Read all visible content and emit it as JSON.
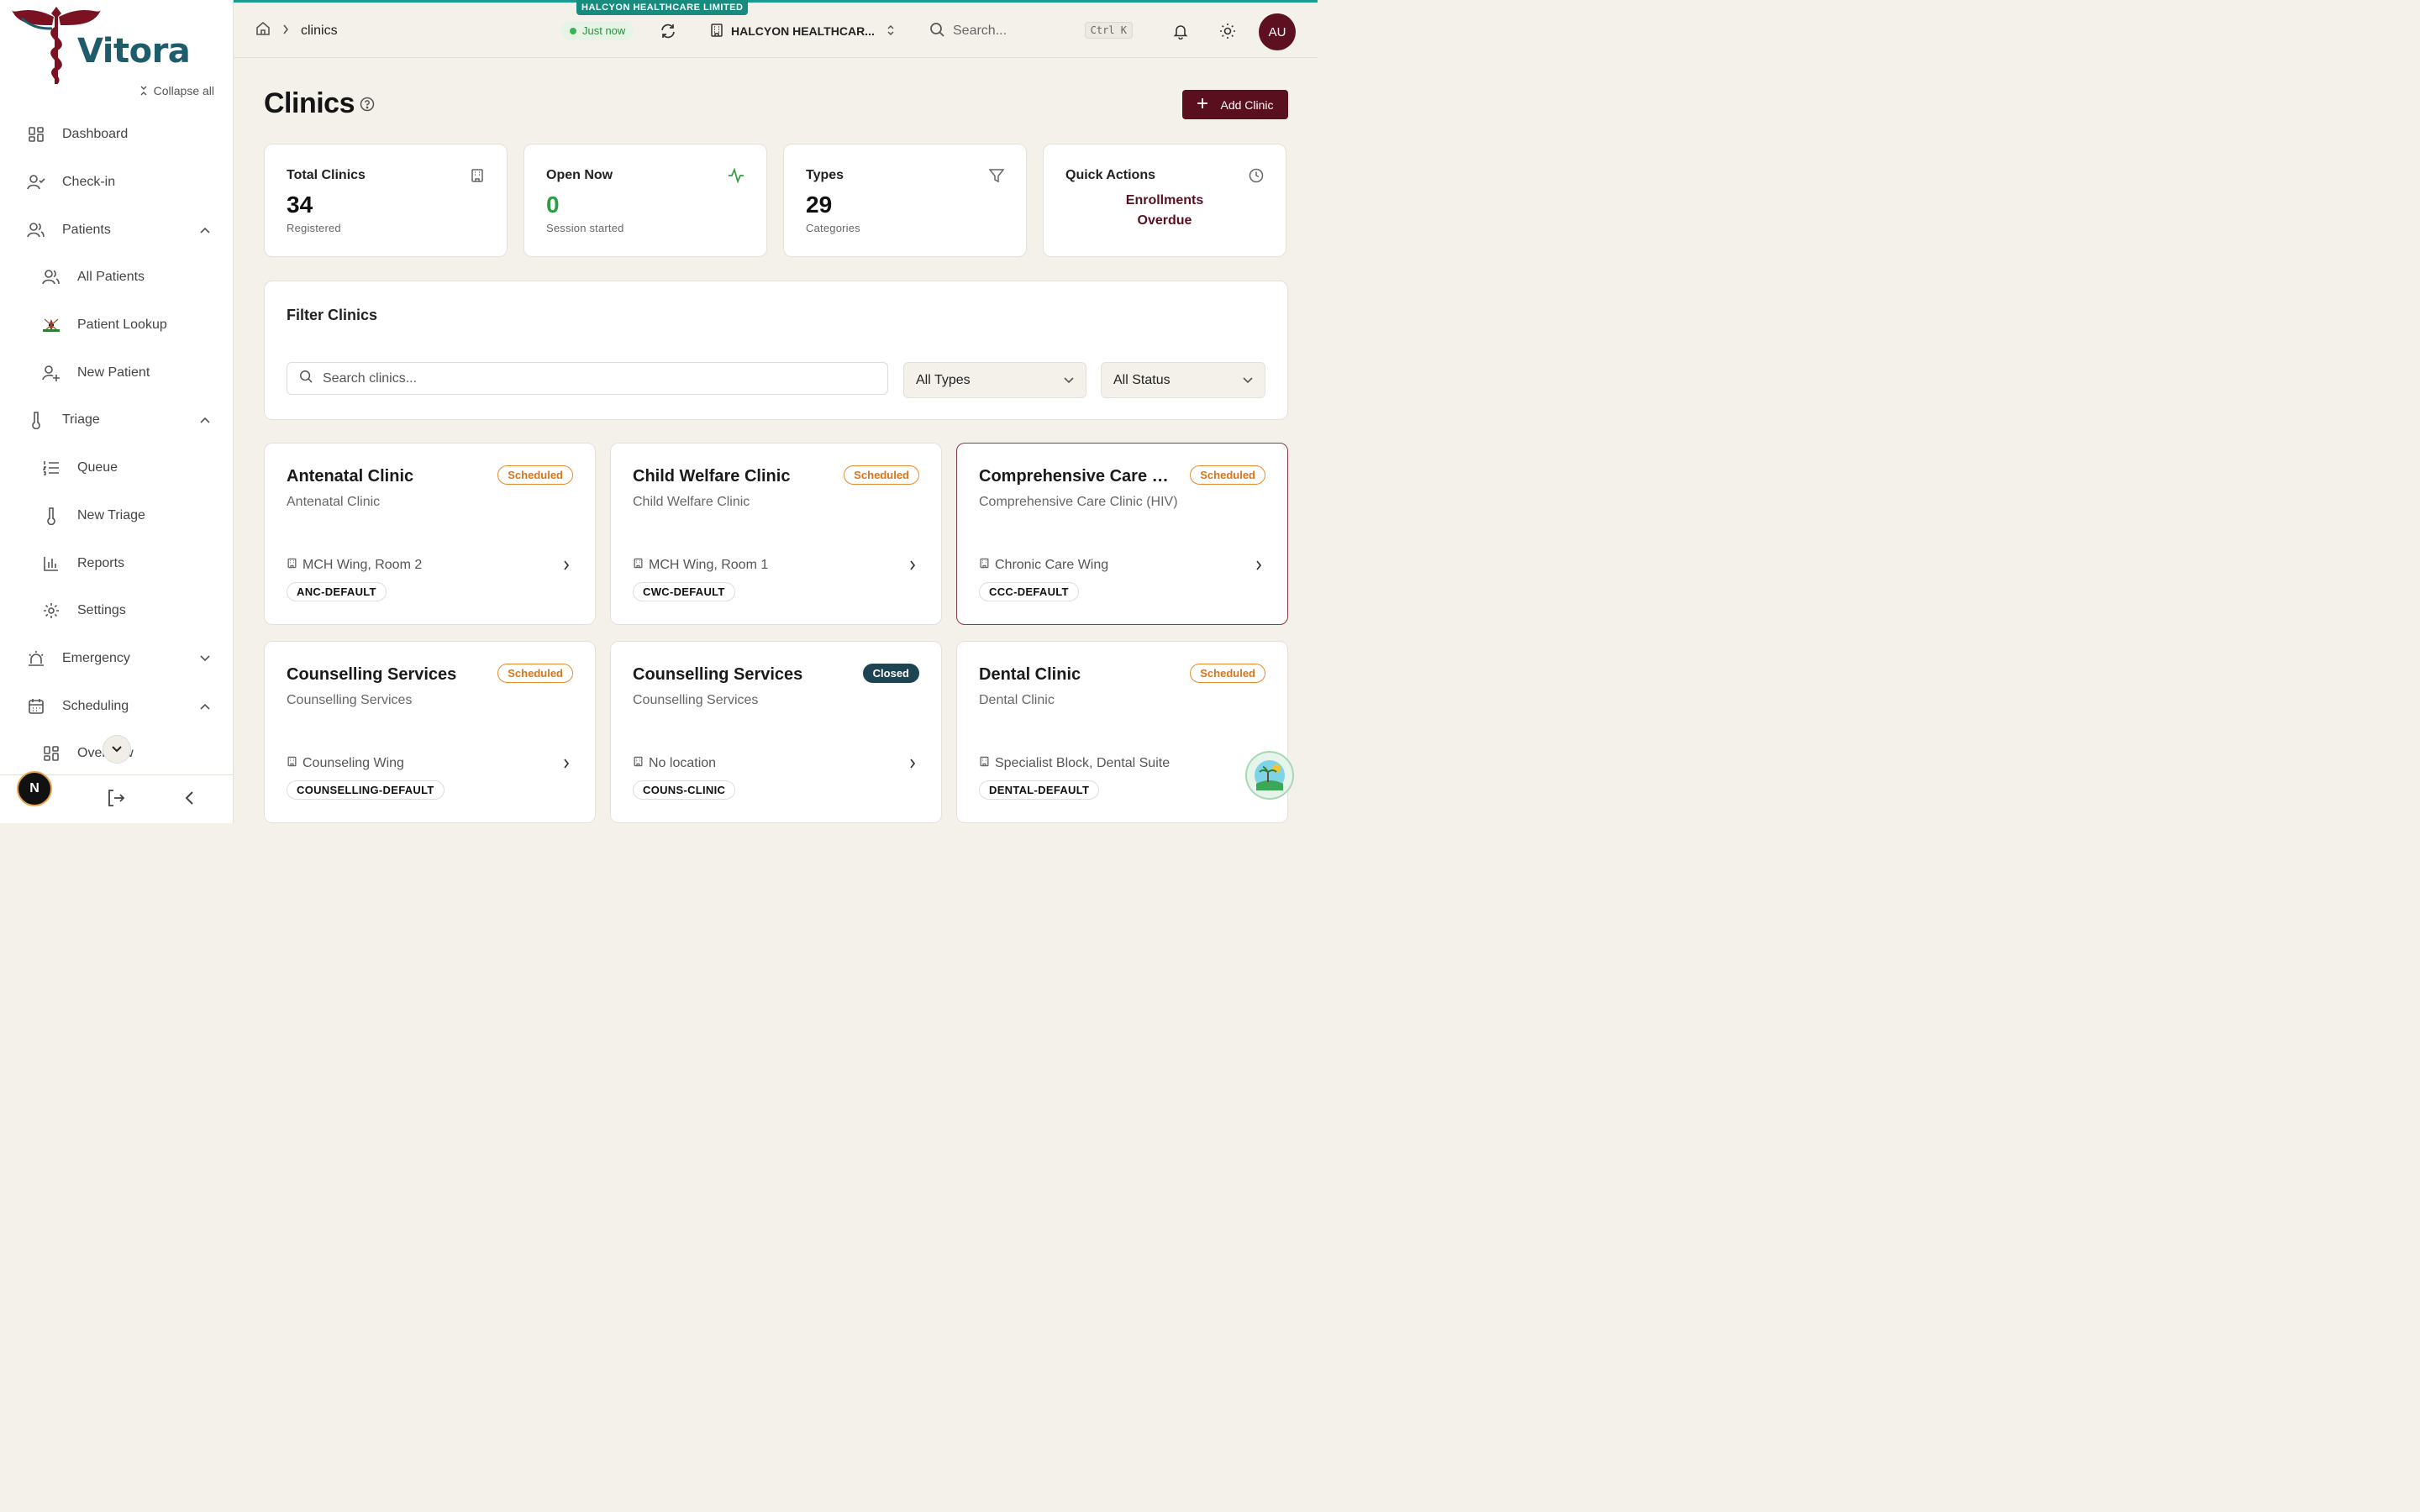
{
  "brand": {
    "name": "Vitora",
    "collapse_all": "Collapse all"
  },
  "nav": [
    {
      "label": "Dashboard",
      "icon": "dashboard-icon"
    },
    {
      "label": "Check-in",
      "icon": "check-in-icon"
    },
    {
      "label": "Patients",
      "icon": "patients-icon",
      "expanded": true
    },
    {
      "label": "All Patients",
      "icon": "users-icon",
      "sub": true
    },
    {
      "label": "Patient Lookup",
      "icon": "lookup-emblem-icon",
      "sub": true
    },
    {
      "label": "New Patient",
      "icon": "user-plus-icon",
      "sub": true
    },
    {
      "label": "Triage",
      "icon": "thermometer-icon",
      "expanded": true
    },
    {
      "label": "Queue",
      "icon": "list-ordered-icon",
      "sub": true
    },
    {
      "label": "New Triage",
      "icon": "thermometer-icon",
      "sub": true
    },
    {
      "label": "Reports",
      "icon": "bar-chart-icon",
      "sub": true
    },
    {
      "label": "Settings",
      "icon": "gear-icon",
      "sub": true
    },
    {
      "label": "Emergency",
      "icon": "siren-icon",
      "expanded": false
    },
    {
      "label": "Scheduling",
      "icon": "calendar-icon",
      "expanded": true
    },
    {
      "label": "Overview",
      "icon": "dashboard-icon",
      "sub": true
    }
  ],
  "footer": {
    "avatar_initial": "N"
  },
  "topbar": {
    "breadcrumb": "clinics",
    "org_banner": "HALCYON HEALTHCARE LIMITED",
    "status": "Just now",
    "org_select": "HALCYON HEALTHCAR...",
    "search_placeholder": "Search...",
    "shortcut_ctrl": "Ctrl",
    "shortcut_key": "K",
    "user_initials": "AU"
  },
  "page": {
    "title": "Clinics",
    "add_button": "Add Clinic"
  },
  "stats": [
    {
      "label": "Total Clinics",
      "value": "34",
      "sub": "Registered",
      "value_color": "#111111"
    },
    {
      "label": "Open Now",
      "value": "0",
      "sub": "Session started",
      "value_color": "#2e9b45"
    },
    {
      "label": "Types",
      "value": "29",
      "sub": "Categories",
      "value_color": "#111111"
    }
  ],
  "quick_actions": {
    "label": "Quick Actions",
    "links": [
      "Enrollments",
      "Overdue"
    ]
  },
  "filter": {
    "title": "Filter Clinics",
    "search_placeholder": "Search clinics...",
    "type_select": "All Types",
    "status_select": "All Status"
  },
  "clinics": [
    {
      "name": "Antenatal Clinic",
      "type": "Antenatal Clinic",
      "status": "Scheduled",
      "location": "MCH Wing, Room 2",
      "code": "ANC-DEFAULT"
    },
    {
      "name": "Child Welfare Clinic",
      "type": "Child Welfare Clinic",
      "status": "Scheduled",
      "location": "MCH Wing, Room 1",
      "code": "CWC-DEFAULT"
    },
    {
      "name": "Comprehensive Care Cl...",
      "type": "Comprehensive Care Clinic (HIV)",
      "status": "Scheduled",
      "location": "Chronic Care Wing",
      "code": "CCC-DEFAULT"
    },
    {
      "name": "Counselling Services",
      "type": "Counselling Services",
      "status": "Scheduled",
      "location": "Counseling Wing",
      "code": "COUNSELLING-DEFAULT"
    },
    {
      "name": "Counselling Services",
      "type": "Counselling Services",
      "status": "Closed",
      "location": "No location",
      "code": "COUNS-CLINIC"
    },
    {
      "name": "Dental Clinic",
      "type": "Dental Clinic",
      "status": "Scheduled",
      "location": "Specialist Block, Dental Suite",
      "code": "DENTAL-DEFAULT"
    }
  ],
  "colors": {
    "accent": "#5a0f1f",
    "teal": "#178c7e",
    "scheduled": "#d97517",
    "closed": "#1d4450"
  }
}
